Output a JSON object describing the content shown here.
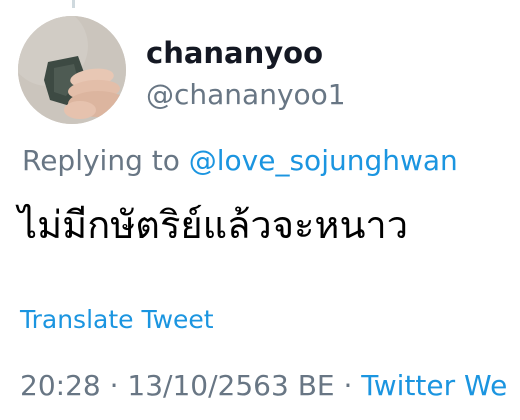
{
  "tweet": {
    "display_name": "chananyoo",
    "handle": "@chananyoo1",
    "replying_to_label": "Replying to ",
    "replying_to_handle": "@love_sojunghwan",
    "text": "ไม่มีกษัตริย์แล้วจะหนาว",
    "translate_label": "Translate Tweet",
    "time": "20:28",
    "separator": " · ",
    "date": "13/10/2563 BE",
    "source": "Twitter We"
  },
  "icons": {
    "avatar": "avatar-photo-hand-holding-object"
  },
  "colors": {
    "link": "#1b95e0",
    "secondary_text": "#687684",
    "primary_text": "#141823"
  }
}
